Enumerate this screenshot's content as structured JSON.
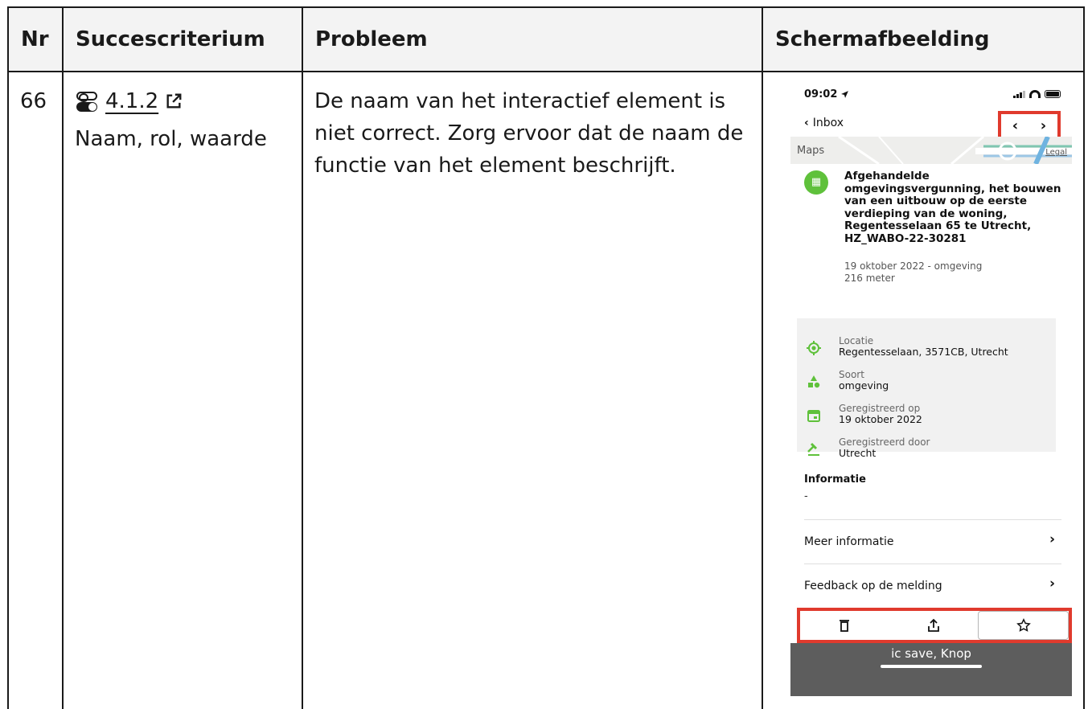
{
  "table": {
    "headers": {
      "nr": "Nr",
      "succescriterium": "Succescriterium",
      "probleem": "Probleem",
      "schermafbeelding": "Schermafbeelding"
    },
    "row": {
      "nr": "66",
      "criterion_number": "4.1.2",
      "criterion_name": "Naam, rol, waarde",
      "problem": "De naam van het interactief element is niet correct. Zorg ervoor dat de naam de functie van het element beschrijft."
    }
  },
  "screenshot": {
    "status_time": "09:02",
    "back_label": "Inbox",
    "prev_arrow": "‹",
    "next_arrow": "›",
    "map_label": "Maps",
    "map_legal": "Legal",
    "avatar_glyph": "▦",
    "notice_title": "Afgehandelde omgevingsvergunning, het bouwen van een uitbouw op de eerste verdieping van de woning, Regentesselaan 65 te Utrecht, HZ_WABO-22-30281",
    "notice_date": "19 oktober 2022 - omgeving",
    "notice_distance": "216 meter",
    "details": [
      {
        "icon": "location-target-icon",
        "label": "Locatie",
        "value": "Regentesselaan, 3571CB, Utrecht"
      },
      {
        "icon": "shapes-icon",
        "label": "Soort",
        "value": "omgeving"
      },
      {
        "icon": "calendar-icon",
        "label": "Geregistreerd op",
        "value": "19 oktober 2022"
      },
      {
        "icon": "gavel-icon",
        "label": "Geregistreerd door",
        "value": "Utrecht"
      }
    ],
    "info_heading": "Informatie",
    "info_value": "-",
    "links": [
      {
        "label": "Meer informatie",
        "arrow": "›"
      },
      {
        "label": "Feedback op de melding",
        "arrow": "›"
      }
    ],
    "voiceover_text": "ic save, Knop",
    "accent_color": "#e03a2d",
    "brand_green": "#5fc13b"
  }
}
